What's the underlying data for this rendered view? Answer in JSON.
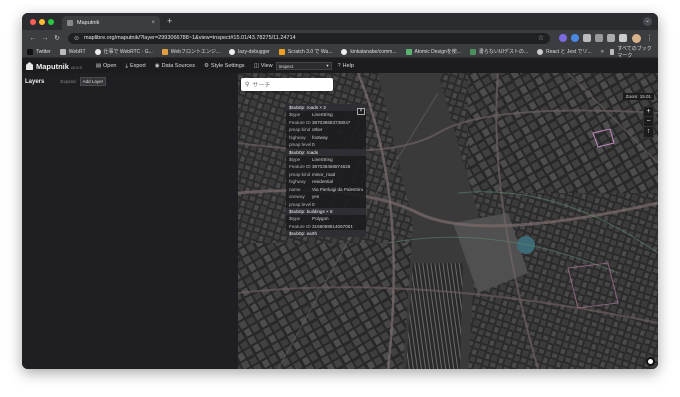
{
  "browser": {
    "tab_title": "Maputnik",
    "tab_close": "×",
    "new_tab": "+",
    "url": "maplibre.org/maputnik/?layer=2993066788~1&view=inspect#15.01/43.78275/11.24714",
    "bookmarks": [
      {
        "label": "Twitter",
        "color": "#1d9bf0"
      },
      {
        "label": "WebRT",
        "color": "#b0b0b0"
      },
      {
        "label": "仕事で WebRTC · G...",
        "color": "#333333"
      },
      {
        "label": "Webフロントエンジ...",
        "color": "#e0a040"
      },
      {
        "label": "lazy-debugger",
        "color": "#888888"
      },
      {
        "label": "Scratch 3.0 で Wa...",
        "color": "#f0a020"
      },
      {
        "label": "kinkatanabe/comm...",
        "color": "#333333"
      },
      {
        "label": "Atomic Designを使...",
        "color": "#5ab46e"
      },
      {
        "label": "書らないUIデストの...",
        "color": "#4a8f5c"
      },
      {
        "label": "React と Jest でリ...",
        "color": "#cccccc"
      }
    ],
    "bookmarks_more": "»",
    "bookmarks_folder": "すべてのブックマーク"
  },
  "app": {
    "logo": "Maputnik",
    "version": "v2.0.0",
    "nav": [
      {
        "icon": "▤",
        "label": "Open"
      },
      {
        "icon": "⤓",
        "label": "Export"
      },
      {
        "icon": "◉",
        "label": "Data Sources"
      },
      {
        "icon": "⚙",
        "label": "Style Settings"
      }
    ],
    "view_label": "View",
    "view_value": "Inspect",
    "help_label": "Help"
  },
  "sidebar": {
    "title": "Layers",
    "expand": "Expand",
    "add_layer": "Add Layer"
  },
  "map": {
    "search_placeholder": "サーチ",
    "zoom_text": "Zoom: 15.01",
    "close": "×",
    "popup": [
      {
        "type": "head",
        "text": "$sub0p: roads × 2"
      },
      {
        "k": "$type",
        "v": "LineString"
      },
      {
        "k": "Feature ID",
        "v": "387038683738047"
      },
      {
        "k": "pmap:kind",
        "v": "other"
      },
      {
        "k": "highway",
        "v": "footway"
      },
      {
        "k": "pmap:level",
        "v": "0"
      },
      {
        "type": "head",
        "text": "$sub0p: roads"
      },
      {
        "k": "$type",
        "v": "LineString"
      },
      {
        "k": "Feature ID",
        "v": "387038466874626"
      },
      {
        "k": "pmap:kind",
        "v": "minor_road"
      },
      {
        "k": "highway",
        "v": "residential"
      },
      {
        "k": "name",
        "v": "Via Pierluigi da Palestrina"
      },
      {
        "k": "oneway",
        "v": "yes"
      },
      {
        "k": "pmap:level",
        "v": "0"
      },
      {
        "type": "head",
        "text": "$sub0p: buildings × 6"
      },
      {
        "k": "$type",
        "v": "Polygon"
      },
      {
        "k": "Feature ID",
        "v": "3168098814067001"
      },
      {
        "type": "head",
        "text": "$sub0p: earth"
      }
    ]
  }
}
